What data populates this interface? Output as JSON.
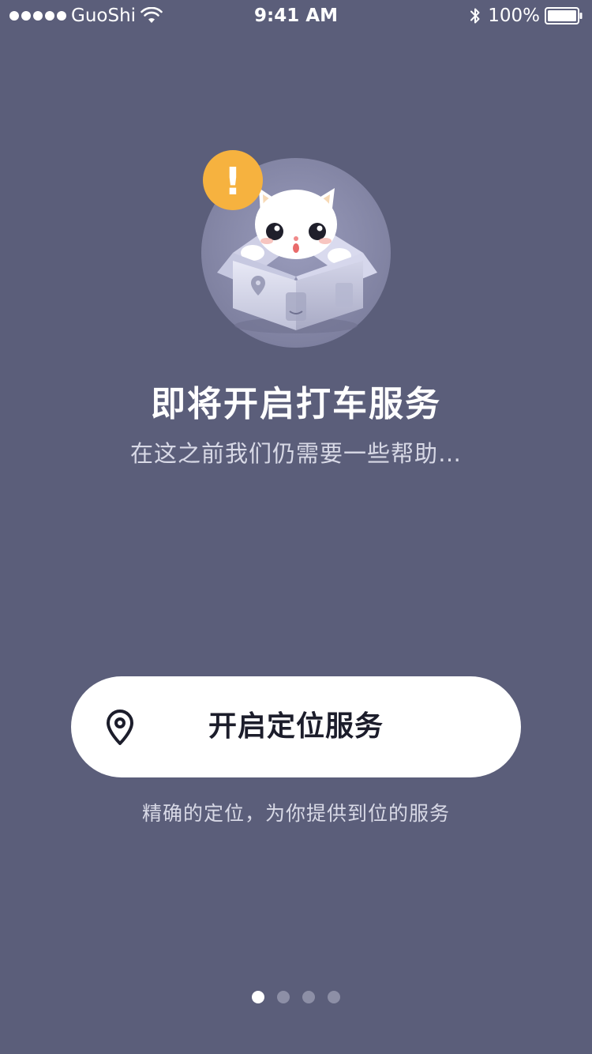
{
  "status_bar": {
    "carrier": "GuoShi",
    "time": "9:41 AM",
    "battery": "100%",
    "signal_icon": "signal-dots-icon",
    "wifi_icon": "wifi-icon",
    "bluetooth_icon": "bluetooth-icon",
    "battery_icon": "battery-icon"
  },
  "illustration": {
    "icon": "cat-in-box-illustration",
    "badge": "!",
    "badge_color": "#f6b23f"
  },
  "intro": {
    "title": "即将开启打车服务",
    "subtitle": "在这之前我们仍需要一些帮助…"
  },
  "cta": {
    "label": "开启定位服务",
    "icon": "location-pin-icon",
    "caption": "精确的定位，为你提供到位的服务"
  },
  "pager": {
    "count": 4,
    "active_index": 0
  },
  "colors": {
    "background": "#5b5e7a",
    "button": "#ffffff",
    "button_text": "#1c1d2b",
    "secondary_text": "#d8d9e6"
  }
}
